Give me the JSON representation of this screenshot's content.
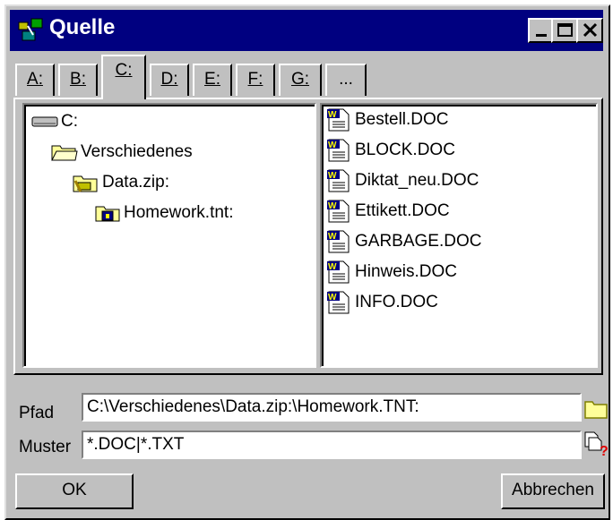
{
  "window": {
    "title": "Quelle"
  },
  "titlebar_buttons": [
    "minimize",
    "maximize",
    "close"
  ],
  "tabs": [
    {
      "label": "A:"
    },
    {
      "label": "B:"
    },
    {
      "label": "C:",
      "active": true
    },
    {
      "label": "D:"
    },
    {
      "label": "E:"
    },
    {
      "label": "F:"
    },
    {
      "label": "G:"
    },
    {
      "label": "..."
    }
  ],
  "tree": [
    {
      "label": "C:",
      "icon": "drive-icon"
    },
    {
      "label": "Verschiedenes",
      "icon": "folder-open-icon"
    },
    {
      "label": "Data.zip:",
      "icon": "zip-folder-icon"
    },
    {
      "label": "Homework.tnt:",
      "icon": "archive-icon"
    }
  ],
  "files": [
    {
      "name": "Bestell.DOC"
    },
    {
      "name": "BLOCK.DOC"
    },
    {
      "name": "Diktat_neu.DOC"
    },
    {
      "name": "Ettikett.DOC"
    },
    {
      "name": "GARBAGE.DOC"
    },
    {
      "name": "Hinweis.DOC"
    },
    {
      "name": "INFO.DOC"
    }
  ],
  "path": {
    "label": "Pfad",
    "value": "C:\\Verschiedenes\\Data.zip:\\Homework.TNT:"
  },
  "mask": {
    "label": "Muster",
    "value": "*.DOC|*.TXT"
  },
  "buttons": {
    "ok": "OK",
    "cancel": "Abbrechen"
  },
  "colors": {
    "titlebar": "#000080",
    "face": "#c0c0c0"
  }
}
